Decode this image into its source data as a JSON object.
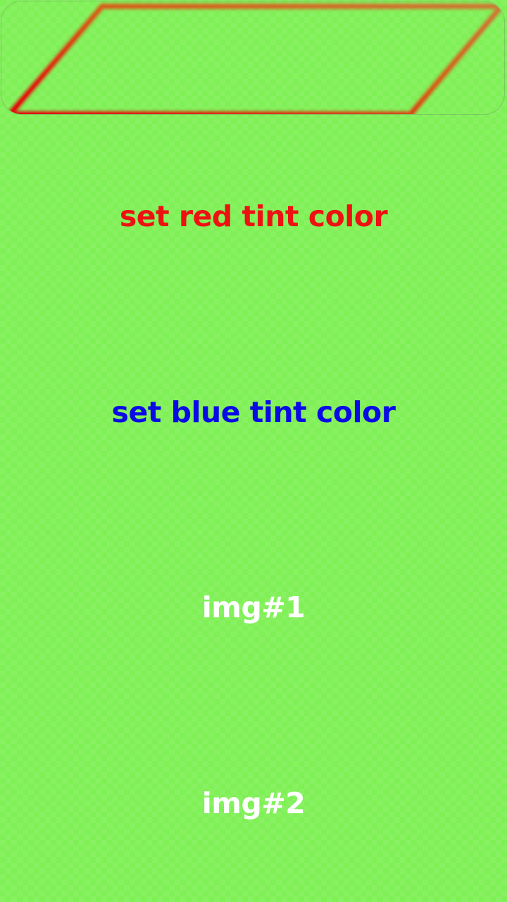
{
  "preview": {
    "image_icon": "parallelogram-gradient-icon",
    "gradient_colors": [
      "#e10a0a",
      "#d4621a",
      "#c98035"
    ],
    "border_color": "#7a9a6e"
  },
  "colors": {
    "background": "#7ff056",
    "red_text": "#ee1111",
    "blue_text": "#0a0ae6",
    "white_text": "#ffffff"
  },
  "buttons": {
    "red_tint": "set red tint color",
    "blue_tint": "set blue tint color",
    "img1": "img#1",
    "img2": "img#2"
  }
}
